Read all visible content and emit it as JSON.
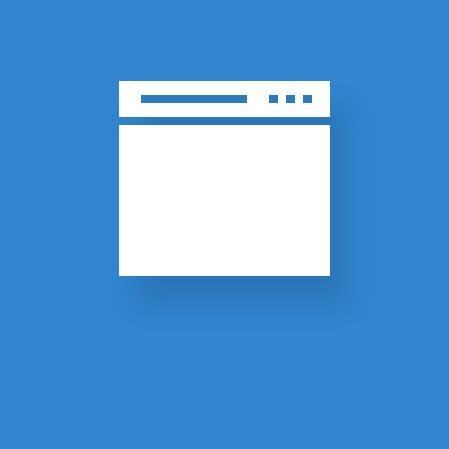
{
  "colors": {
    "background": "#3186cf",
    "window": "#ffffff",
    "accent": "#2f79bd"
  },
  "icon": {
    "name": "browser-window-icon"
  }
}
